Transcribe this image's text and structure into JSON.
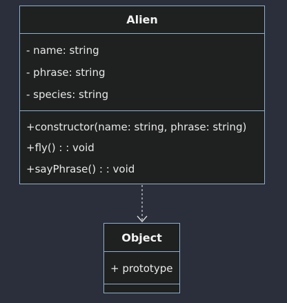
{
  "diagram": {
    "classes": [
      {
        "id": "alien",
        "name": "Alien",
        "attributes": [
          "- name: string",
          "- phrase: string",
          "- species: string"
        ],
        "methods": [
          "+constructor(name: string, phrase: string)",
          "+fly() : : void",
          "+sayPhrase() : : void"
        ]
      },
      {
        "id": "object",
        "name": "Object",
        "attributes": [
          "+ prototype"
        ],
        "methods": []
      }
    ],
    "relations": [
      {
        "from": "alien",
        "to": "object",
        "type": "dependency"
      }
    ],
    "colors": {
      "background": "#2b2f3b",
      "box_fill": "#1f2020",
      "box_border": "#8fb2cf",
      "text": "#e8e8e8",
      "edge": "#d8d8d8"
    }
  }
}
